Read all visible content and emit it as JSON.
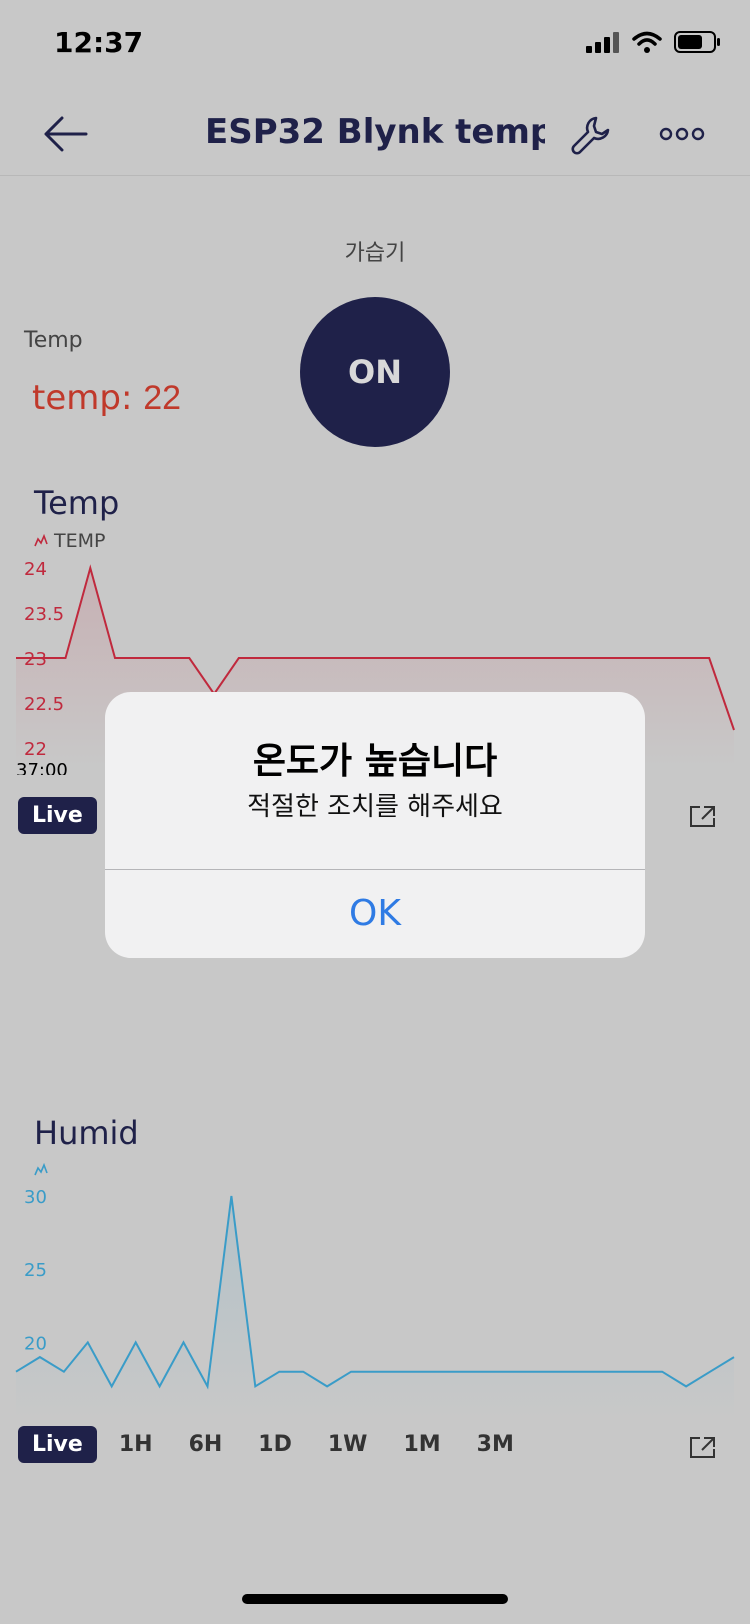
{
  "status": {
    "time": "12:37"
  },
  "header": {
    "title": "ESP32 Blynk temp..."
  },
  "switch_widget": {
    "label": "가습기",
    "state": "ON"
  },
  "temp_widget": {
    "label": "Temp",
    "prefix": "temp:",
    "value": "22"
  },
  "chart_data": [
    {
      "type": "area",
      "title": "Temp",
      "series": [
        {
          "name": "TEMP",
          "color": "#c0293d",
          "values": [
            23,
            23,
            23,
            24,
            23,
            23,
            23,
            23,
            22.6,
            23,
            23,
            23,
            23,
            23,
            23,
            23,
            23,
            23,
            23,
            23,
            23,
            23,
            23,
            23,
            23,
            23,
            23,
            23,
            23,
            22.2
          ]
        }
      ],
      "y_ticks": [
        "24",
        "23.5",
        "23",
        "22.5",
        "22"
      ],
      "ylim": [
        22,
        24
      ],
      "x_tick_label": "37:00"
    },
    {
      "type": "area",
      "title": "Humid",
      "series": [
        {
          "name": "",
          "color": "#3a9cc8",
          "values": [
            18,
            19,
            18,
            20,
            17,
            20,
            17,
            20,
            17,
            30,
            17,
            18,
            18,
            17,
            18,
            18,
            18,
            18,
            18,
            18,
            18,
            18,
            18,
            18,
            18,
            18,
            18,
            18,
            17,
            18,
            19
          ]
        }
      ],
      "y_ticks": [
        "30",
        "25",
        "20"
      ],
      "ylim": [
        16,
        30
      ]
    }
  ],
  "temp_range": {
    "live": "Live"
  },
  "humid_range": {
    "buttons": [
      "Live",
      "1H",
      "6H",
      "1D",
      "1W",
      "1M",
      "3M"
    ]
  },
  "alert": {
    "title": "온도가 높습니다",
    "message": "적절한 조치를 해주세요",
    "ok": "OK"
  },
  "colors": {
    "navy": "#1f2149",
    "red": "#c0293d",
    "blue": "#3a9cc8",
    "link": "#2f7be4"
  }
}
